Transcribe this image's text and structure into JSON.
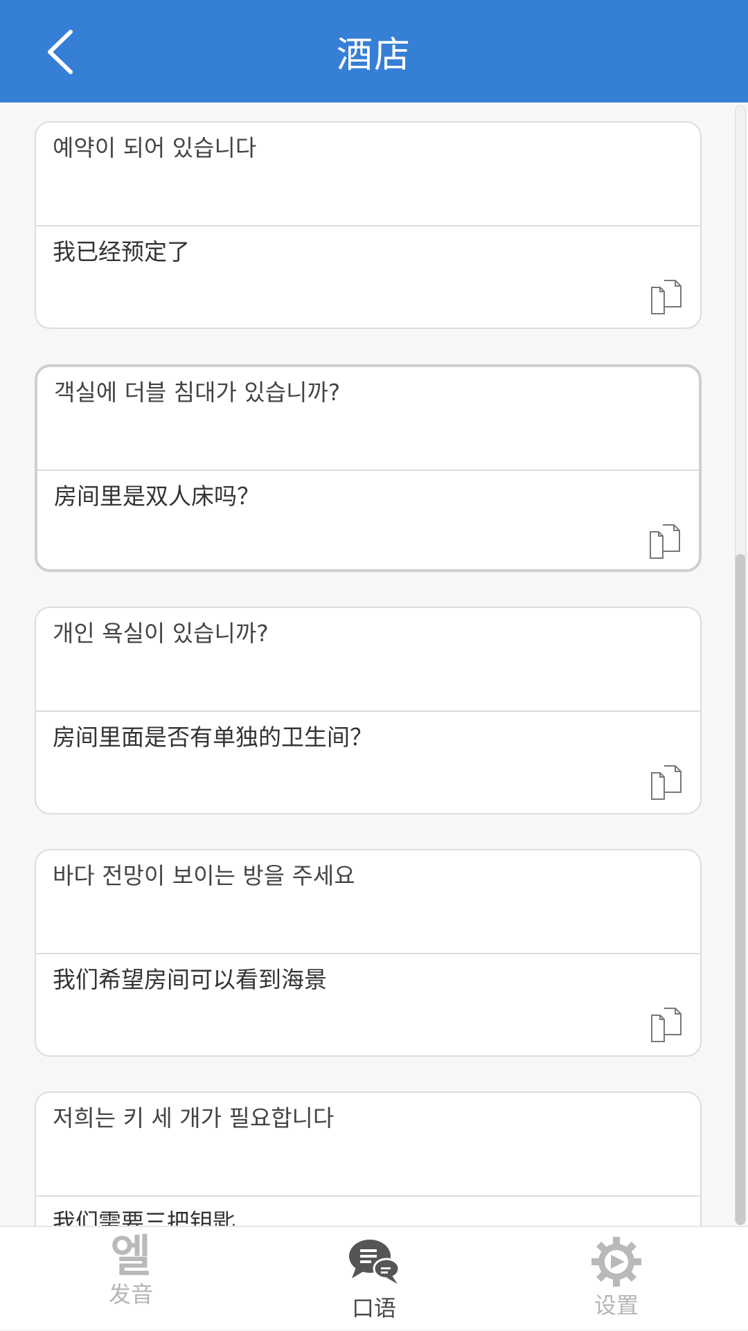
{
  "header": {
    "title": "酒店",
    "back_icon": "chevron-left-icon"
  },
  "phrases": [
    {
      "korean": "예약이 되어 있습니다",
      "chinese": "我已经预定了"
    },
    {
      "korean": "객실에 더블 침대가 있습니까?",
      "chinese": "房间里是双人床吗？"
    },
    {
      "korean": "개인 욕실이 있습니까?",
      "chinese": "房间里面是否有单独的卫生间？"
    },
    {
      "korean": "바다 전망이 보이는 방을 주세요",
      "chinese": "我们希望房间可以看到海景"
    },
    {
      "korean": "저희는 키 세 개가 필요합니다",
      "chinese": "我们需要三把钥匙"
    }
  ],
  "tabs": [
    {
      "label": "发音",
      "icon": "hangul-icon",
      "glyph": "엘",
      "active": false
    },
    {
      "label": "口语",
      "icon": "chat-bubbles-icon",
      "active": true
    },
    {
      "label": "设置",
      "icon": "gear-icon",
      "active": false
    }
  ],
  "colors": {
    "header_bg": "#367fd6",
    "active_tab": "#4a4a4a",
    "inactive_tab": "#b5b5b5"
  }
}
